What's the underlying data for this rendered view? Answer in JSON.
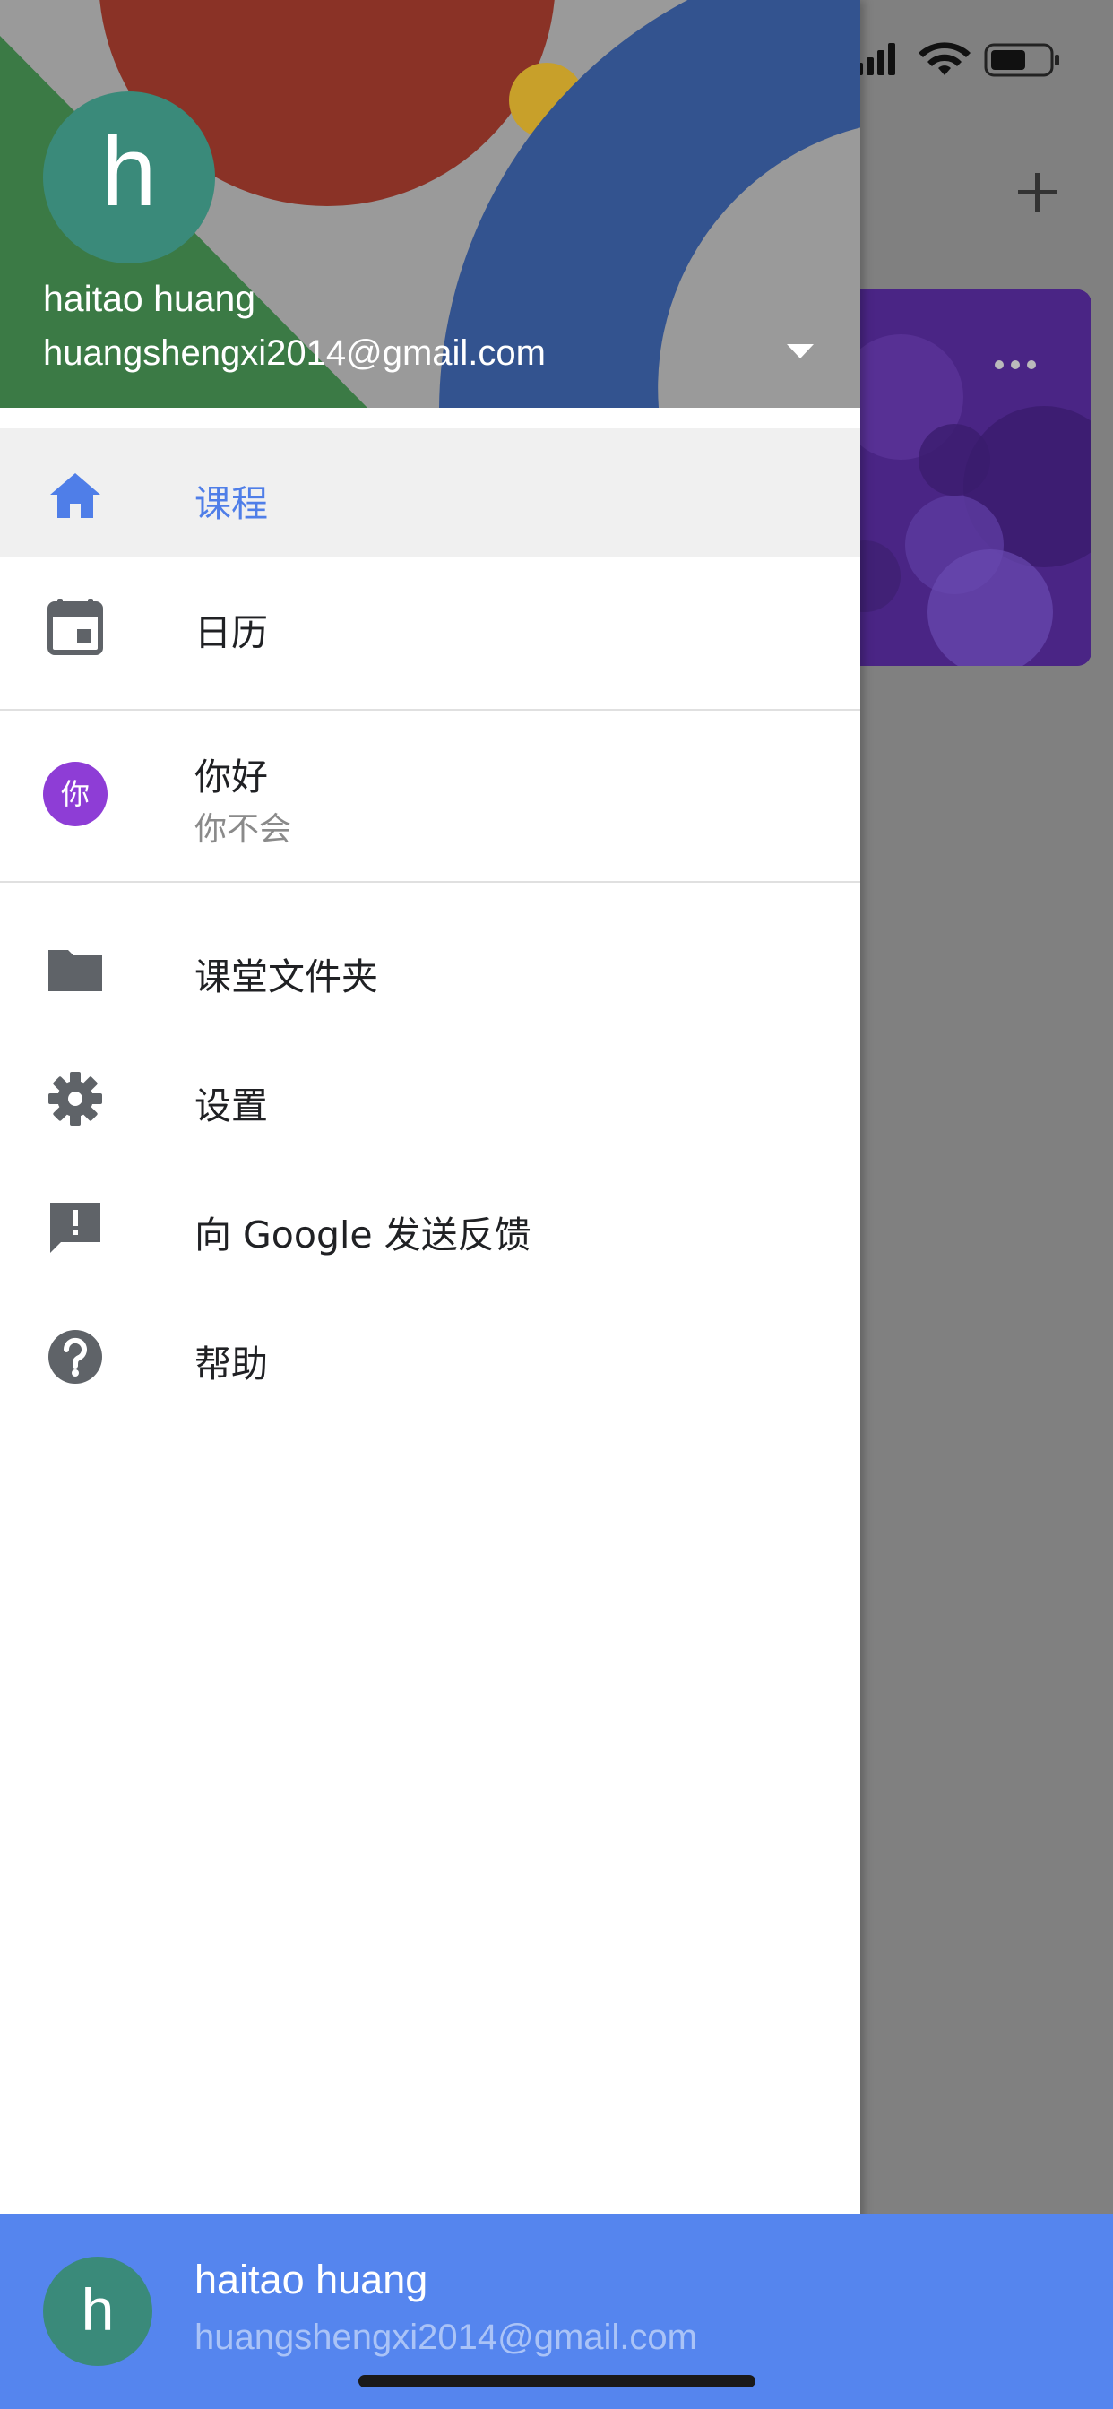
{
  "account": {
    "avatar_letter": "h",
    "name": "haitao huang",
    "email": "huangshengxi2014@gmail.com"
  },
  "nav": {
    "courses": "课程",
    "calendar": "日历",
    "class_folders": "课堂文件夹",
    "settings": "设置",
    "feedback": "向 Google 发送反馈",
    "help": "帮助"
  },
  "class": {
    "avatar_char": "你",
    "title": "你好",
    "subtitle": "你不会"
  },
  "colors": {
    "accent": "#4f7ee8",
    "bottom_bar": "#5585ee",
    "avatar": "#3a8a7a",
    "class_avatar": "#8e3dd6"
  },
  "icons": [
    "home-icon",
    "calendar-icon",
    "folder-icon",
    "gear-icon",
    "feedback-icon",
    "help-icon",
    "dropdown-icon",
    "add-icon",
    "more-icon",
    "signal-icon",
    "wifi-icon",
    "battery-icon"
  ]
}
